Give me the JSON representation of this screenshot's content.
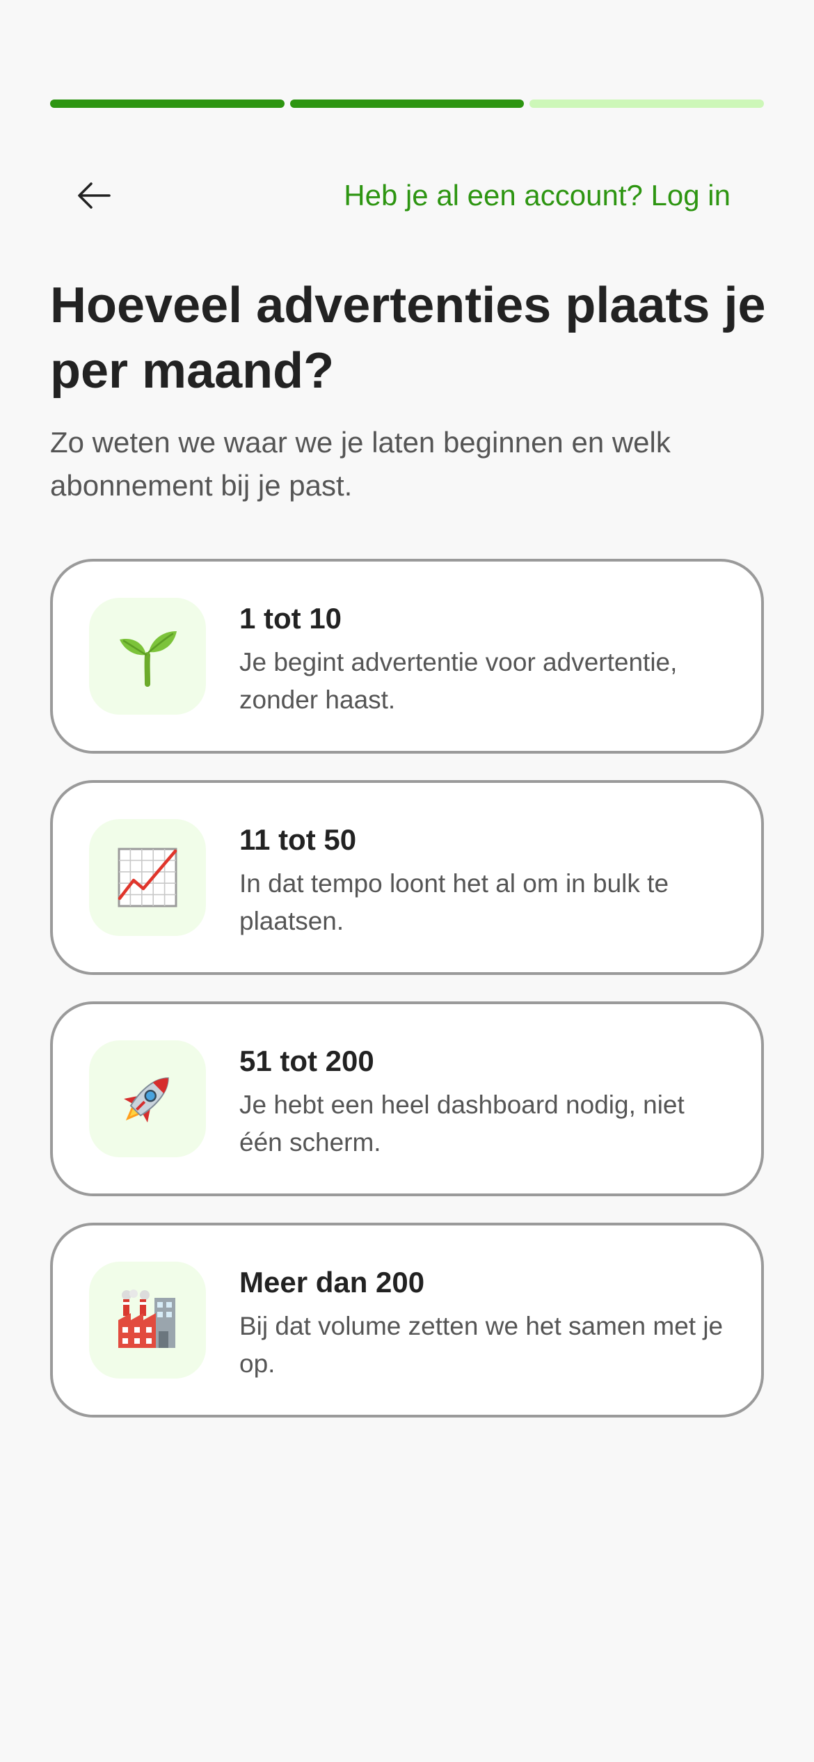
{
  "progress": {
    "total_steps": 3,
    "completed_steps": 2
  },
  "header": {
    "back_icon": "arrow-left-icon",
    "login_link": "Heb je al een account? Log in"
  },
  "main": {
    "title": "Hoeveel advertenties plaats je per maand?",
    "subtitle": "Zo weten we waar we je laten beginnen en welk abonnement bij je past."
  },
  "options": [
    {
      "title": "1 tot 10",
      "description": "Je begint advertentie voor advertentie, zonder haast.",
      "icon": "seedling-icon"
    },
    {
      "title": "11 tot 50",
      "description": "In dat tempo loont het al om in bulk te plaatsen.",
      "icon": "chart-increasing-icon"
    },
    {
      "title": "51 tot 200",
      "description": "Je hebt een heel dashboard nodig, niet één scherm.",
      "icon": "rocket-icon"
    },
    {
      "title": "Meer dan 200",
      "description": "Bij dat volume zetten we het samen met je op.",
      "icon": "factory-icon"
    }
  ],
  "colors": {
    "accent": "#2d9511",
    "progress_inactive": "#cdf7b8",
    "icon_tile_bg": "#f1fde9",
    "card_border": "#9a9a9a",
    "background": "#f8f8f8"
  }
}
